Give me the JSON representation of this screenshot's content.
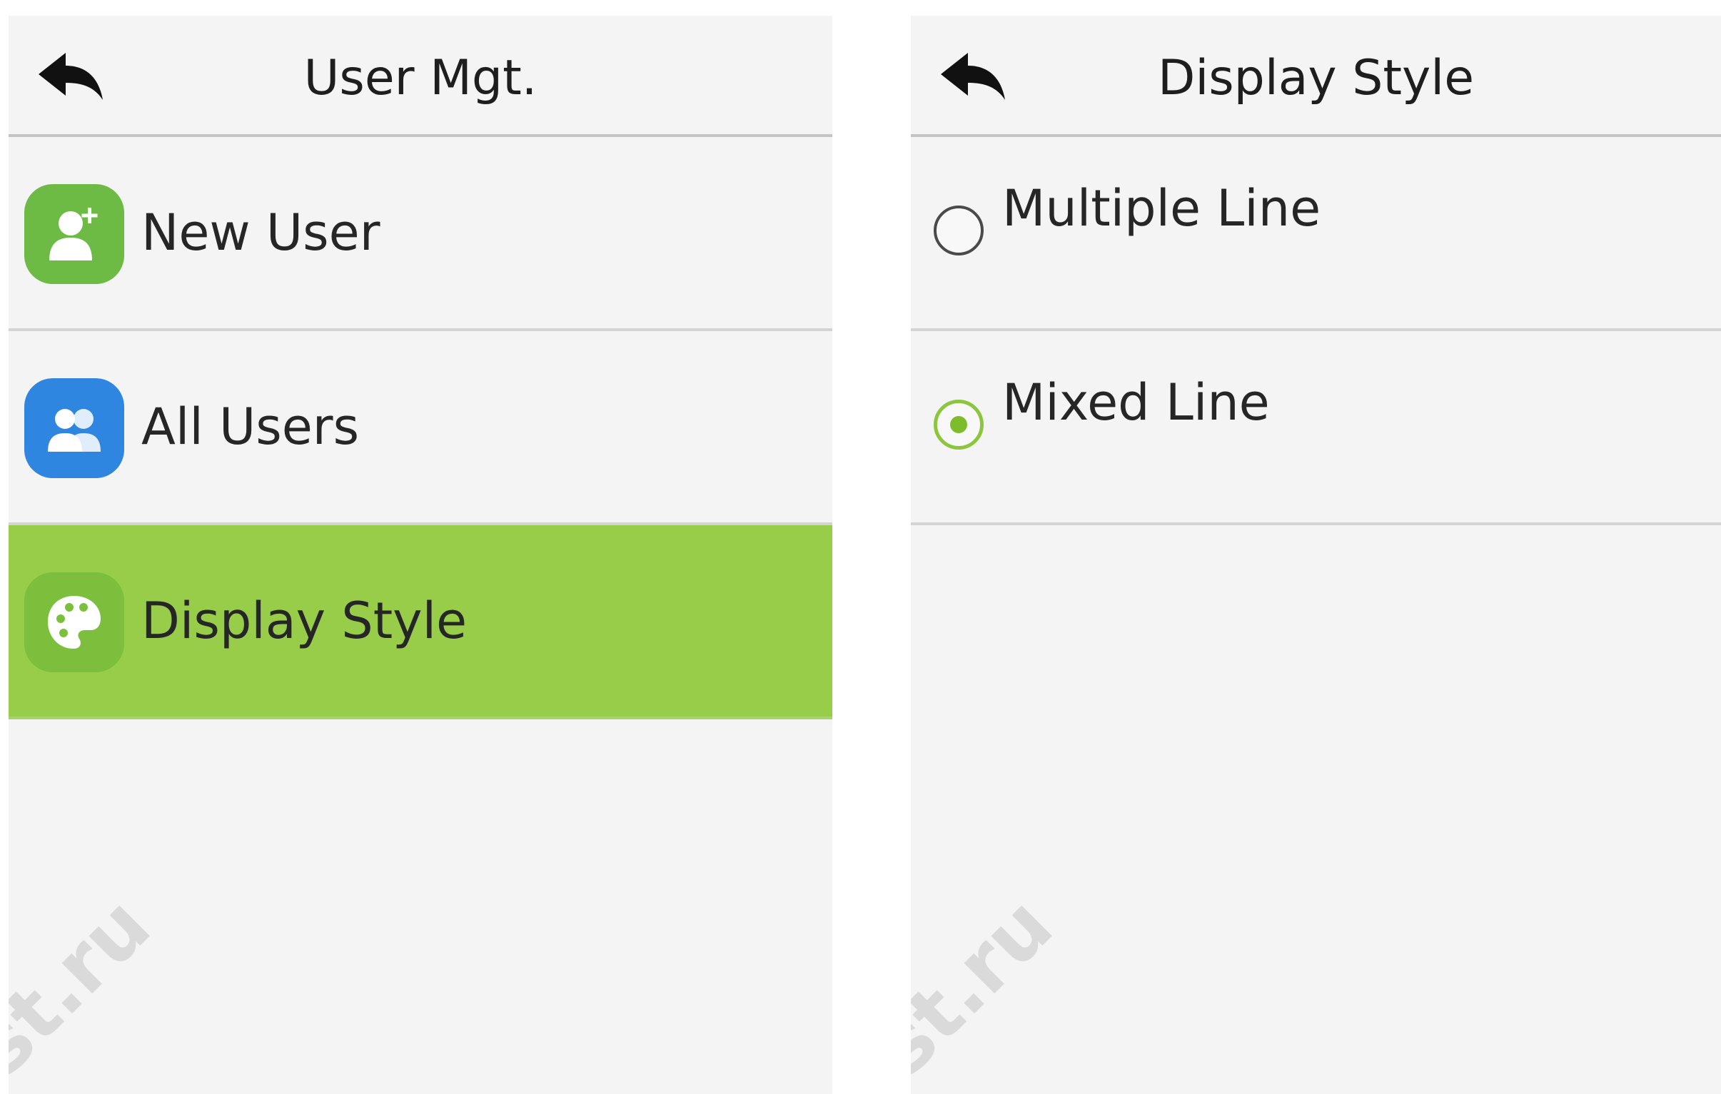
{
  "left_screen": {
    "title": "User Mgt.",
    "items": [
      {
        "label": "New User",
        "icon": "add-user-icon",
        "icon_color": "#6dbb45",
        "selected": false
      },
      {
        "label": "All Users",
        "icon": "users-icon",
        "icon_color": "#2e86e0",
        "selected": false
      },
      {
        "label": "Display Style",
        "icon": "palette-icon",
        "icon_color": "#7cbf3c",
        "selected": true
      }
    ],
    "selected_color": "#97cd48"
  },
  "right_screen": {
    "title": "Display Style",
    "options": [
      {
        "label": "Multiple Line",
        "checked": false
      },
      {
        "label": "Mixed Line",
        "checked": true
      }
    ],
    "radio_accent": "#8cc63f"
  },
  "watermark": {
    "text_left": "st.ru",
    "text_right": "st.ru"
  }
}
